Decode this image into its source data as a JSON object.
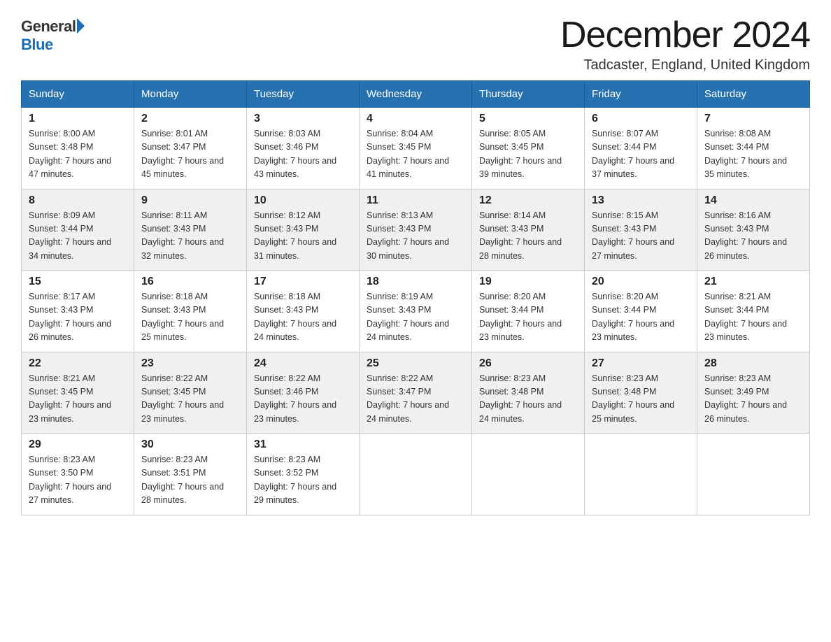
{
  "logo": {
    "text_general": "General",
    "text_blue": "Blue",
    "arrow": "▶"
  },
  "title": "December 2024",
  "location": "Tadcaster, England, United Kingdom",
  "weekdays": [
    "Sunday",
    "Monday",
    "Tuesday",
    "Wednesday",
    "Thursday",
    "Friday",
    "Saturday"
  ],
  "weeks": [
    [
      {
        "day": "1",
        "sunrise": "8:00 AM",
        "sunset": "3:48 PM",
        "daylight": "7 hours and 47 minutes."
      },
      {
        "day": "2",
        "sunrise": "8:01 AM",
        "sunset": "3:47 PM",
        "daylight": "7 hours and 45 minutes."
      },
      {
        "day": "3",
        "sunrise": "8:03 AM",
        "sunset": "3:46 PM",
        "daylight": "7 hours and 43 minutes."
      },
      {
        "day": "4",
        "sunrise": "8:04 AM",
        "sunset": "3:45 PM",
        "daylight": "7 hours and 41 minutes."
      },
      {
        "day": "5",
        "sunrise": "8:05 AM",
        "sunset": "3:45 PM",
        "daylight": "7 hours and 39 minutes."
      },
      {
        "day": "6",
        "sunrise": "8:07 AM",
        "sunset": "3:44 PM",
        "daylight": "7 hours and 37 minutes."
      },
      {
        "day": "7",
        "sunrise": "8:08 AM",
        "sunset": "3:44 PM",
        "daylight": "7 hours and 35 minutes."
      }
    ],
    [
      {
        "day": "8",
        "sunrise": "8:09 AM",
        "sunset": "3:44 PM",
        "daylight": "7 hours and 34 minutes."
      },
      {
        "day": "9",
        "sunrise": "8:11 AM",
        "sunset": "3:43 PM",
        "daylight": "7 hours and 32 minutes."
      },
      {
        "day": "10",
        "sunrise": "8:12 AM",
        "sunset": "3:43 PM",
        "daylight": "7 hours and 31 minutes."
      },
      {
        "day": "11",
        "sunrise": "8:13 AM",
        "sunset": "3:43 PM",
        "daylight": "7 hours and 30 minutes."
      },
      {
        "day": "12",
        "sunrise": "8:14 AM",
        "sunset": "3:43 PM",
        "daylight": "7 hours and 28 minutes."
      },
      {
        "day": "13",
        "sunrise": "8:15 AM",
        "sunset": "3:43 PM",
        "daylight": "7 hours and 27 minutes."
      },
      {
        "day": "14",
        "sunrise": "8:16 AM",
        "sunset": "3:43 PM",
        "daylight": "7 hours and 26 minutes."
      }
    ],
    [
      {
        "day": "15",
        "sunrise": "8:17 AM",
        "sunset": "3:43 PM",
        "daylight": "7 hours and 26 minutes."
      },
      {
        "day": "16",
        "sunrise": "8:18 AM",
        "sunset": "3:43 PM",
        "daylight": "7 hours and 25 minutes."
      },
      {
        "day": "17",
        "sunrise": "8:18 AM",
        "sunset": "3:43 PM",
        "daylight": "7 hours and 24 minutes."
      },
      {
        "day": "18",
        "sunrise": "8:19 AM",
        "sunset": "3:43 PM",
        "daylight": "7 hours and 24 minutes."
      },
      {
        "day": "19",
        "sunrise": "8:20 AM",
        "sunset": "3:44 PM",
        "daylight": "7 hours and 23 minutes."
      },
      {
        "day": "20",
        "sunrise": "8:20 AM",
        "sunset": "3:44 PM",
        "daylight": "7 hours and 23 minutes."
      },
      {
        "day": "21",
        "sunrise": "8:21 AM",
        "sunset": "3:44 PM",
        "daylight": "7 hours and 23 minutes."
      }
    ],
    [
      {
        "day": "22",
        "sunrise": "8:21 AM",
        "sunset": "3:45 PM",
        "daylight": "7 hours and 23 minutes."
      },
      {
        "day": "23",
        "sunrise": "8:22 AM",
        "sunset": "3:45 PM",
        "daylight": "7 hours and 23 minutes."
      },
      {
        "day": "24",
        "sunrise": "8:22 AM",
        "sunset": "3:46 PM",
        "daylight": "7 hours and 23 minutes."
      },
      {
        "day": "25",
        "sunrise": "8:22 AM",
        "sunset": "3:47 PM",
        "daylight": "7 hours and 24 minutes."
      },
      {
        "day": "26",
        "sunrise": "8:23 AM",
        "sunset": "3:48 PM",
        "daylight": "7 hours and 24 minutes."
      },
      {
        "day": "27",
        "sunrise": "8:23 AM",
        "sunset": "3:48 PM",
        "daylight": "7 hours and 25 minutes."
      },
      {
        "day": "28",
        "sunrise": "8:23 AM",
        "sunset": "3:49 PM",
        "daylight": "7 hours and 26 minutes."
      }
    ],
    [
      {
        "day": "29",
        "sunrise": "8:23 AM",
        "sunset": "3:50 PM",
        "daylight": "7 hours and 27 minutes."
      },
      {
        "day": "30",
        "sunrise": "8:23 AM",
        "sunset": "3:51 PM",
        "daylight": "7 hours and 28 minutes."
      },
      {
        "day": "31",
        "sunrise": "8:23 AM",
        "sunset": "3:52 PM",
        "daylight": "7 hours and 29 minutes."
      },
      null,
      null,
      null,
      null
    ]
  ]
}
